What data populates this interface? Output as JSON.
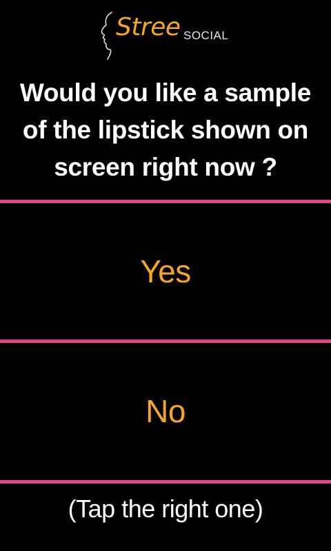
{
  "header": {
    "logo": {
      "brand": "Stree",
      "sub": "SOCIAL",
      "icon": "face-profile-icon"
    }
  },
  "question": {
    "text": "Would you like a sample of the lipstick shown on screen right now ?"
  },
  "options": [
    {
      "label": "Yes"
    },
    {
      "label": "No"
    }
  ],
  "hint": "(Tap the right one)",
  "colors": {
    "background": "#000000",
    "accent": "#f5a623",
    "divider": "#e8408a",
    "text": "#ffffff"
  }
}
